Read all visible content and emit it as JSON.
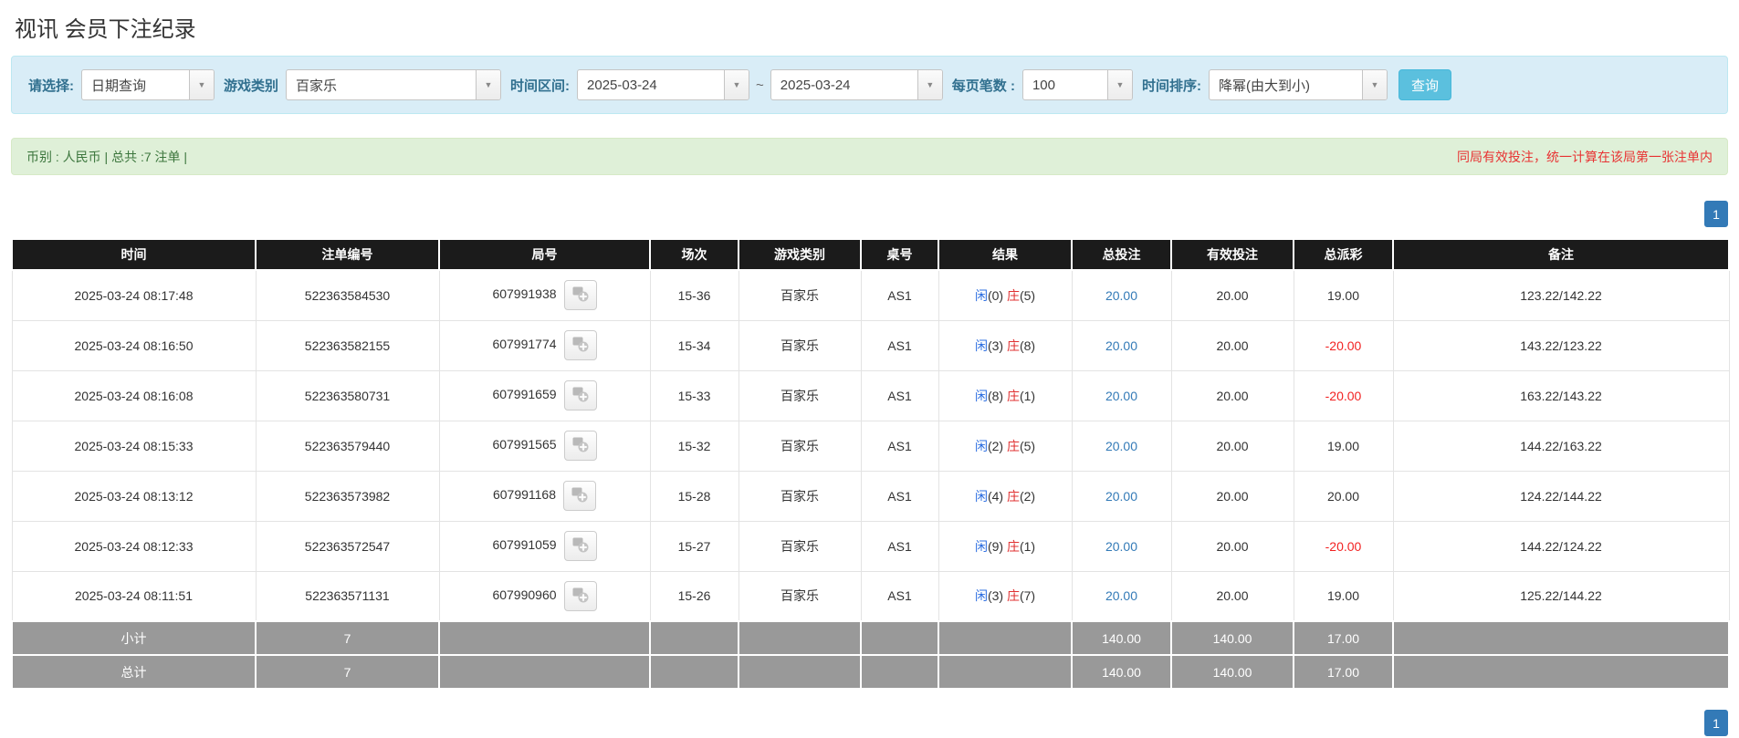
{
  "page": {
    "title": "视讯 会员下注纪录"
  },
  "filters": {
    "select_label": "请选择:",
    "select_value": "日期查询",
    "game_label": "游戏类别",
    "game_value": "百家乐",
    "range_label": "时间区间:",
    "date_from": "2025-03-24",
    "tilde": "~",
    "date_to": "2025-03-24",
    "per_page_label": "每页笔数 :",
    "per_page_value": "100",
    "sort_label": "时间排序:",
    "sort_value": "降幂(由大到小)",
    "query_button": "查询"
  },
  "summary": {
    "left": "币别 : 人民币 | 总共 :7 注单 |",
    "right_note": "同局有效投注，统一计算在该局第一张注单内"
  },
  "pagination": {
    "current_page": "1"
  },
  "icons": {
    "chevron": "▼",
    "video_icon_name": "video-record-icon"
  },
  "colors": {
    "header-bg": "#1b1b1b",
    "subtotal-bg": "#999999",
    "link-blue": "#337ab7",
    "result-blue": "#2a6ce0",
    "result-red": "#e03131",
    "neg-red": "#f22222",
    "btn-cyan": "#5bc0de",
    "filter-bg": "#d9edf7",
    "summary-bg": "#dff0d8",
    "summary-text": "#3c763d",
    "note-red": "#e83333"
  },
  "table": {
    "headers": [
      "时间",
      "注单编号",
      "局号",
      "场次",
      "游戏类别",
      "桌号",
      "结果",
      "总投注",
      "有效投注",
      "总派彩",
      "备注"
    ],
    "rows": [
      {
        "time": "2025-03-24 08:17:48",
        "bet_id": "522363584530",
        "round_id": "607991938",
        "session": "15-36",
        "game": "百家乐",
        "table_no": "AS1",
        "result": {
          "player_label": "闲",
          "player_count": "(0)",
          "banker_label": "庄",
          "banker_count": "(5)"
        },
        "total_bet": "20.00",
        "valid_bet": "20.00",
        "payout": "19.00",
        "payout_negative": false,
        "remark": "123.22/142.22"
      },
      {
        "time": "2025-03-24 08:16:50",
        "bet_id": "522363582155",
        "round_id": "607991774",
        "session": "15-34",
        "game": "百家乐",
        "table_no": "AS1",
        "result": {
          "player_label": "闲",
          "player_count": "(3)",
          "banker_label": "庄",
          "banker_count": "(8)"
        },
        "total_bet": "20.00",
        "valid_bet": "20.00",
        "payout": "-20.00",
        "payout_negative": true,
        "remark": "143.22/123.22"
      },
      {
        "time": "2025-03-24 08:16:08",
        "bet_id": "522363580731",
        "round_id": "607991659",
        "session": "15-33",
        "game": "百家乐",
        "table_no": "AS1",
        "result": {
          "player_label": "闲",
          "player_count": "(8)",
          "banker_label": "庄",
          "banker_count": "(1)"
        },
        "total_bet": "20.00",
        "valid_bet": "20.00",
        "payout": "-20.00",
        "payout_negative": true,
        "remark": "163.22/143.22"
      },
      {
        "time": "2025-03-24 08:15:33",
        "bet_id": "522363579440",
        "round_id": "607991565",
        "session": "15-32",
        "game": "百家乐",
        "table_no": "AS1",
        "result": {
          "player_label": "闲",
          "player_count": "(2)",
          "banker_label": "庄",
          "banker_count": "(5)"
        },
        "total_bet": "20.00",
        "valid_bet": "20.00",
        "payout": "19.00",
        "payout_negative": false,
        "remark": "144.22/163.22"
      },
      {
        "time": "2025-03-24 08:13:12",
        "bet_id": "522363573982",
        "round_id": "607991168",
        "session": "15-28",
        "game": "百家乐",
        "table_no": "AS1",
        "result": {
          "player_label": "闲",
          "player_count": "(4)",
          "banker_label": "庄",
          "banker_count": "(2)"
        },
        "total_bet": "20.00",
        "valid_bet": "20.00",
        "payout": "20.00",
        "payout_negative": false,
        "remark": "124.22/144.22"
      },
      {
        "time": "2025-03-24 08:12:33",
        "bet_id": "522363572547",
        "round_id": "607991059",
        "session": "15-27",
        "game": "百家乐",
        "table_no": "AS1",
        "result": {
          "player_label": "闲",
          "player_count": "(9)",
          "banker_label": "庄",
          "banker_count": "(1)"
        },
        "total_bet": "20.00",
        "valid_bet": "20.00",
        "payout": "-20.00",
        "payout_negative": true,
        "remark": "144.22/124.22"
      },
      {
        "time": "2025-03-24 08:11:51",
        "bet_id": "522363571131",
        "round_id": "607990960",
        "session": "15-26",
        "game": "百家乐",
        "table_no": "AS1",
        "result": {
          "player_label": "闲",
          "player_count": "(3)",
          "banker_label": "庄",
          "banker_count": "(7)"
        },
        "total_bet": "20.00",
        "valid_bet": "20.00",
        "payout": "19.00",
        "payout_negative": false,
        "remark": "125.22/144.22"
      }
    ],
    "summary_rows": [
      {
        "label": "小计",
        "count": "7",
        "total_bet": "140.00",
        "valid_bet": "140.00",
        "payout": "17.00"
      },
      {
        "label": "总计",
        "count": "7",
        "total_bet": "140.00",
        "valid_bet": "140.00",
        "payout": "17.00"
      }
    ]
  }
}
